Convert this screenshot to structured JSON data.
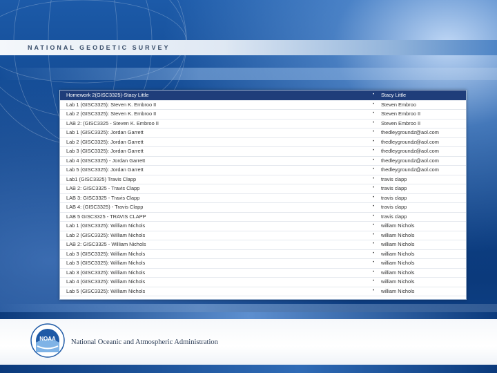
{
  "header": {
    "title": "NATIONAL GEODETIC SURVEY"
  },
  "rows": [
    {
      "title": "Homework 2(GISC3325)-Stacy Little",
      "author": "Stacy Little",
      "highlight": true
    },
    {
      "title": "Lab 1 (GISC3325): Steven K. Embroo II",
      "author": "Steven Embroo"
    },
    {
      "title": "Lab 2 (GISC3325): Steven K. Embroo II",
      "author": "Steven Embroo II"
    },
    {
      "title": "LAB 2: (GISC3325 - Steven K. Embroo II",
      "author": "Steven Embroo II"
    },
    {
      "title": "Lab 1 (GISC3325): Jordan Garrett",
      "author": "thedleygroundz@aol.com"
    },
    {
      "title": "Lab 2 (GISC3325): Jordan Garrett",
      "author": "thedleygroundz@aol.com"
    },
    {
      "title": "Lab 3 (GISC3325): Jordan Garrett",
      "author": "thedleygroundz@aol.com"
    },
    {
      "title": "Lab 4 (GISC3325) - Jordan Garrett",
      "author": "thedleygroundz@aol.com"
    },
    {
      "title": "Lab 5 (GISC3325): Jordan Garrett",
      "author": "thedleygroundz@aol.com"
    },
    {
      "title": "Lab1 (GISC3325) Travis Clapp",
      "author": "travis clapp"
    },
    {
      "title": "LAB 2: GISC3325 - Travis Clapp",
      "author": "travis clapp"
    },
    {
      "title": "LAB 3: GISC3325 - Travis Clapp",
      "author": "travis clapp"
    },
    {
      "title": "LAB 4: (GISC3325) - Travis Clapp",
      "author": "travis clapp"
    },
    {
      "title": "LAB 5 GISC3325 - TRAVIS CLAPP",
      "author": "travis clapp"
    },
    {
      "title": "Lab 1 (GISC3325): William Nichols",
      "author": "william Nichols"
    },
    {
      "title": "Lab 2 (GISC3325): William Nichols",
      "author": "william Nichols"
    },
    {
      "title": "LAB 2: GISC3325 - William Nichols",
      "author": "william Nichols"
    },
    {
      "title": "Lab 3 (GISC3325): William Nichols",
      "author": "william Nichols"
    },
    {
      "title": "Lab 3 (GISC3325): William Nichols",
      "author": "william Nichols"
    },
    {
      "title": "Lab 3 (GISC3325): William Nichols",
      "author": "william Nichols"
    },
    {
      "title": "Lab 4 (GISC3325): William Nichols",
      "author": "william Nichols"
    },
    {
      "title": "Lab 5 (GISC3325): William Nichols",
      "author": "william Nichols"
    }
  ],
  "bullet": "•",
  "footer": {
    "agency": "National Oceanic and Atmospheric Administration",
    "logo_text": "NOAA"
  },
  "colors": {
    "highlight_row": "#1f3d7a",
    "background": "#0d3f7a"
  }
}
